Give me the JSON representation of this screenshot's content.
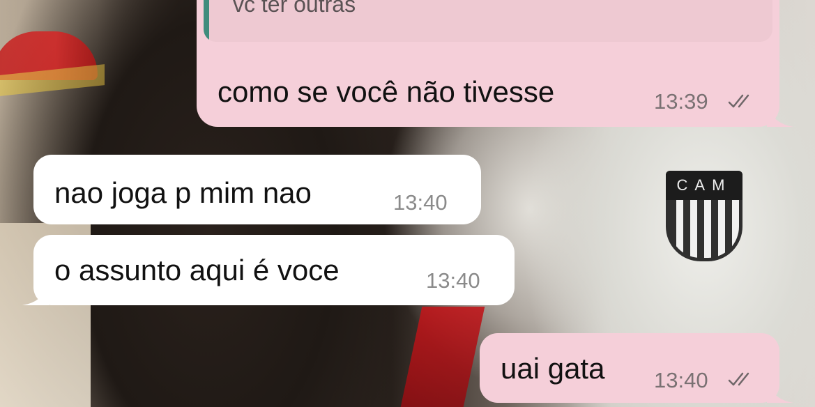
{
  "chat": {
    "messages": [
      {
        "direction": "outgoing",
        "quoted_text": "vc ter outras",
        "text": "como se você não tivesse",
        "time": "13:39",
        "status": "read-ticks-icon"
      },
      {
        "direction": "incoming",
        "text": "nao joga p mim nao",
        "time": "13:40"
      },
      {
        "direction": "incoming",
        "text": "o assunto aqui é voce",
        "time": "13:40"
      },
      {
        "direction": "outgoing",
        "text": "uai gata",
        "time": "13:40",
        "status": "read-ticks-icon"
      }
    ]
  },
  "colors": {
    "outgoing_bubble": "#f5cfd9",
    "incoming_bubble": "#ffffff",
    "quote_accent": "#3f8c7c",
    "timestamp": "#7a7173"
  }
}
